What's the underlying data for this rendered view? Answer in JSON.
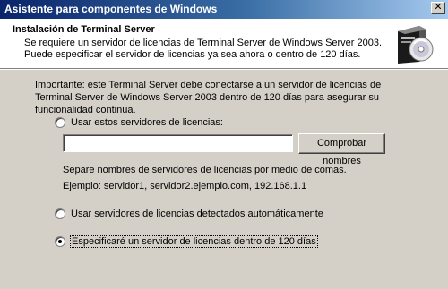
{
  "window": {
    "title": "Asistente para componentes de Windows",
    "close_glyph": "✕"
  },
  "header": {
    "title": "Instalación de Terminal Server",
    "subtitle": "Se requiere un servidor de licencias de Terminal Server de Windows Server 2003. Puede especificar el servidor de licencias ya sea ahora o dentro de 120 días.",
    "icon": "cd-box-icon"
  },
  "body": {
    "notice": "Importante: este Terminal Server debe conectarse a un servidor de licencias de Terminal Server de Windows Server 2003 dentro de 120 días para asegurar su funcionalidad continua.",
    "option_specify_label": "Usar estos servidores de licencias:",
    "server_input_value": "",
    "check_names_button": "Comprobar nombres",
    "separator_hint": "Separe nombres de servidores de licencias por medio de comas.",
    "example_hint": "Ejemplo: servidor1, servidor2.ejemplo.com, 192.168.1.1",
    "option_autodetect_label": "Usar servidores de licencias detectados automáticamente",
    "option_later_label": "Especificaré un servidor de licencias dentro de 120 días",
    "selected_option": "later"
  }
}
